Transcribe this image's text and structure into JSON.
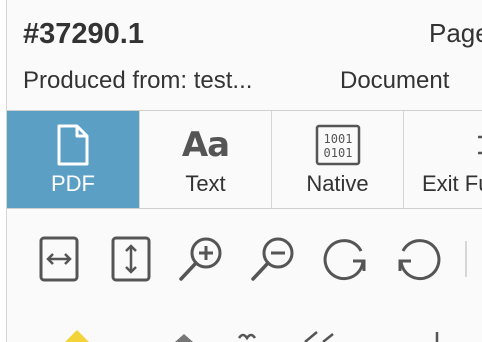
{
  "header": {
    "doc_id": "#37290.1",
    "page_label": "Page",
    "produced_from": "Produced from: test...",
    "document_label": "Document"
  },
  "view_tabs": [
    {
      "label": "PDF",
      "icon": "document-icon",
      "active": true
    },
    {
      "label": "Text",
      "icon": "Aa",
      "active": false
    },
    {
      "label": "Native",
      "icon": "binary-file-icon",
      "binary_lines": [
        "1001",
        "0101"
      ],
      "active": false
    },
    {
      "label": "Exit Fu",
      "icon": "exit-fullscreen-icon",
      "active": false
    }
  ],
  "toolbar": {
    "tools": [
      {
        "name": "fit-width-icon"
      },
      {
        "name": "fit-height-icon"
      },
      {
        "name": "zoom-in-icon"
      },
      {
        "name": "zoom-out-icon"
      },
      {
        "name": "rotate-clockwise-icon"
      },
      {
        "name": "rotate-counterclockwise-icon"
      }
    ]
  },
  "colors": {
    "active_tab": "#5b9fc4",
    "icon": "#555555",
    "text": "#333333",
    "highlighter": "#f2d33a"
  }
}
